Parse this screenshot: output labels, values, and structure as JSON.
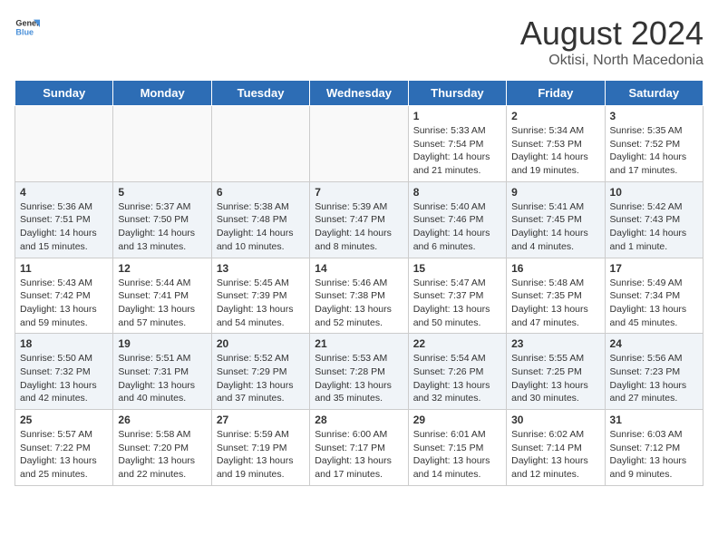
{
  "header": {
    "logo_general": "General",
    "logo_blue": "Blue",
    "title": "August 2024",
    "subtitle": "Oktisi, North Macedonia"
  },
  "weekdays": [
    "Sunday",
    "Monday",
    "Tuesday",
    "Wednesday",
    "Thursday",
    "Friday",
    "Saturday"
  ],
  "weeks": [
    [
      {
        "day": "",
        "info": "",
        "row": "odd"
      },
      {
        "day": "",
        "info": "",
        "row": "odd"
      },
      {
        "day": "",
        "info": "",
        "row": "odd"
      },
      {
        "day": "",
        "info": "",
        "row": "odd"
      },
      {
        "day": "1",
        "info": "Sunrise: 5:33 AM\nSunset: 7:54 PM\nDaylight: 14 hours\nand 21 minutes.",
        "row": "odd"
      },
      {
        "day": "2",
        "info": "Sunrise: 5:34 AM\nSunset: 7:53 PM\nDaylight: 14 hours\nand 19 minutes.",
        "row": "odd"
      },
      {
        "day": "3",
        "info": "Sunrise: 5:35 AM\nSunset: 7:52 PM\nDaylight: 14 hours\nand 17 minutes.",
        "row": "odd"
      }
    ],
    [
      {
        "day": "4",
        "info": "Sunrise: 5:36 AM\nSunset: 7:51 PM\nDaylight: 14 hours\nand 15 minutes.",
        "row": "even"
      },
      {
        "day": "5",
        "info": "Sunrise: 5:37 AM\nSunset: 7:50 PM\nDaylight: 14 hours\nand 13 minutes.",
        "row": "even"
      },
      {
        "day": "6",
        "info": "Sunrise: 5:38 AM\nSunset: 7:48 PM\nDaylight: 14 hours\nand 10 minutes.",
        "row": "even"
      },
      {
        "day": "7",
        "info": "Sunrise: 5:39 AM\nSunset: 7:47 PM\nDaylight: 14 hours\nand 8 minutes.",
        "row": "even"
      },
      {
        "day": "8",
        "info": "Sunrise: 5:40 AM\nSunset: 7:46 PM\nDaylight: 14 hours\nand 6 minutes.",
        "row": "even"
      },
      {
        "day": "9",
        "info": "Sunrise: 5:41 AM\nSunset: 7:45 PM\nDaylight: 14 hours\nand 4 minutes.",
        "row": "even"
      },
      {
        "day": "10",
        "info": "Sunrise: 5:42 AM\nSunset: 7:43 PM\nDaylight: 14 hours\nand 1 minute.",
        "row": "even"
      }
    ],
    [
      {
        "day": "11",
        "info": "Sunrise: 5:43 AM\nSunset: 7:42 PM\nDaylight: 13 hours\nand 59 minutes.",
        "row": "odd"
      },
      {
        "day": "12",
        "info": "Sunrise: 5:44 AM\nSunset: 7:41 PM\nDaylight: 13 hours\nand 57 minutes.",
        "row": "odd"
      },
      {
        "day": "13",
        "info": "Sunrise: 5:45 AM\nSunset: 7:39 PM\nDaylight: 13 hours\nand 54 minutes.",
        "row": "odd"
      },
      {
        "day": "14",
        "info": "Sunrise: 5:46 AM\nSunset: 7:38 PM\nDaylight: 13 hours\nand 52 minutes.",
        "row": "odd"
      },
      {
        "day": "15",
        "info": "Sunrise: 5:47 AM\nSunset: 7:37 PM\nDaylight: 13 hours\nand 50 minutes.",
        "row": "odd"
      },
      {
        "day": "16",
        "info": "Sunrise: 5:48 AM\nSunset: 7:35 PM\nDaylight: 13 hours\nand 47 minutes.",
        "row": "odd"
      },
      {
        "day": "17",
        "info": "Sunrise: 5:49 AM\nSunset: 7:34 PM\nDaylight: 13 hours\nand 45 minutes.",
        "row": "odd"
      }
    ],
    [
      {
        "day": "18",
        "info": "Sunrise: 5:50 AM\nSunset: 7:32 PM\nDaylight: 13 hours\nand 42 minutes.",
        "row": "even"
      },
      {
        "day": "19",
        "info": "Sunrise: 5:51 AM\nSunset: 7:31 PM\nDaylight: 13 hours\nand 40 minutes.",
        "row": "even"
      },
      {
        "day": "20",
        "info": "Sunrise: 5:52 AM\nSunset: 7:29 PM\nDaylight: 13 hours\nand 37 minutes.",
        "row": "even"
      },
      {
        "day": "21",
        "info": "Sunrise: 5:53 AM\nSunset: 7:28 PM\nDaylight: 13 hours\nand 35 minutes.",
        "row": "even"
      },
      {
        "day": "22",
        "info": "Sunrise: 5:54 AM\nSunset: 7:26 PM\nDaylight: 13 hours\nand 32 minutes.",
        "row": "even"
      },
      {
        "day": "23",
        "info": "Sunrise: 5:55 AM\nSunset: 7:25 PM\nDaylight: 13 hours\nand 30 minutes.",
        "row": "even"
      },
      {
        "day": "24",
        "info": "Sunrise: 5:56 AM\nSunset: 7:23 PM\nDaylight: 13 hours\nand 27 minutes.",
        "row": "even"
      }
    ],
    [
      {
        "day": "25",
        "info": "Sunrise: 5:57 AM\nSunset: 7:22 PM\nDaylight: 13 hours\nand 25 minutes.",
        "row": "odd"
      },
      {
        "day": "26",
        "info": "Sunrise: 5:58 AM\nSunset: 7:20 PM\nDaylight: 13 hours\nand 22 minutes.",
        "row": "odd"
      },
      {
        "day": "27",
        "info": "Sunrise: 5:59 AM\nSunset: 7:19 PM\nDaylight: 13 hours\nand 19 minutes.",
        "row": "odd"
      },
      {
        "day": "28",
        "info": "Sunrise: 6:00 AM\nSunset: 7:17 PM\nDaylight: 13 hours\nand 17 minutes.",
        "row": "odd"
      },
      {
        "day": "29",
        "info": "Sunrise: 6:01 AM\nSunset: 7:15 PM\nDaylight: 13 hours\nand 14 minutes.",
        "row": "odd"
      },
      {
        "day": "30",
        "info": "Sunrise: 6:02 AM\nSunset: 7:14 PM\nDaylight: 13 hours\nand 12 minutes.",
        "row": "odd"
      },
      {
        "day": "31",
        "info": "Sunrise: 6:03 AM\nSunset: 7:12 PM\nDaylight: 13 hours\nand 9 minutes.",
        "row": "odd"
      }
    ]
  ]
}
